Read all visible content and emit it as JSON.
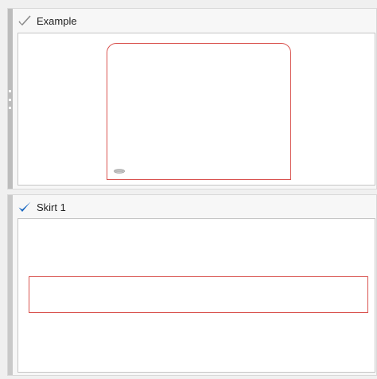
{
  "panels": [
    {
      "title": "Example",
      "checked": false,
      "icon": "check-outline-icon"
    },
    {
      "title": "Skirt 1",
      "checked": true,
      "icon": "check-blue-icon"
    }
  ],
  "colors": {
    "outline_red": "#d9534f",
    "check_blue": "#1565c0",
    "check_outline_grey": "#8a8a8a",
    "background": "#f0f0f0"
  }
}
